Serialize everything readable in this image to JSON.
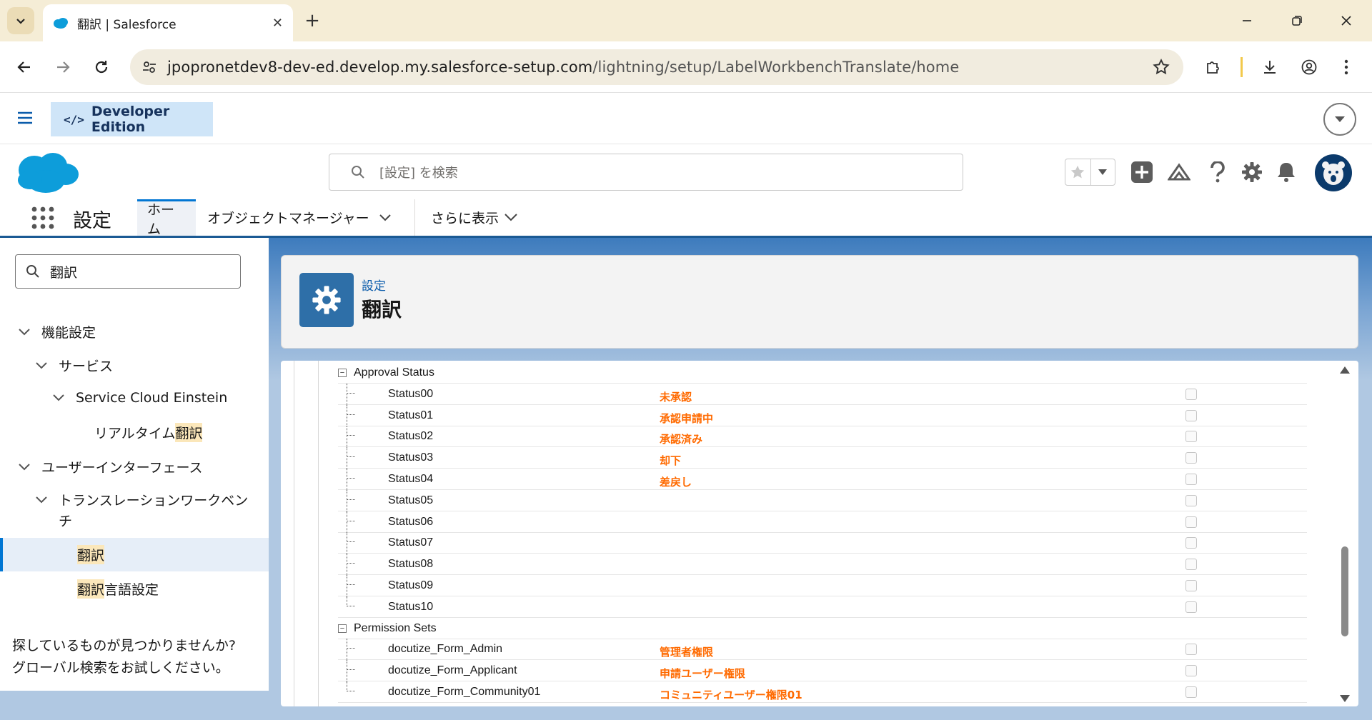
{
  "browser": {
    "tab_title": "翻訳 | Salesforce",
    "url_host": "jpopronetdev8-dev-ed.develop.my.salesforce-setup.com",
    "url_path": "/lightning/setup/LabelWorkbenchTranslate/home"
  },
  "devbar": {
    "edition_label": "Developer Edition"
  },
  "header": {
    "search_placeholder": "[設定] を検索"
  },
  "appnav": {
    "app_name": "設定",
    "tabs": [
      {
        "label": "ホーム"
      },
      {
        "label": "オブジェクトマネージャー"
      },
      {
        "label": "さらに表示"
      }
    ]
  },
  "sidebar": {
    "search_value": "翻訳",
    "items": [
      {
        "label": "機能設定"
      },
      {
        "label": "サービス"
      },
      {
        "label": "Service Cloud Einstein"
      },
      {
        "label_pre": "リアルタイム",
        "label_hl": "翻訳"
      },
      {
        "label": "ユーザーインターフェース"
      },
      {
        "label_line1": "トランスレーションワークベン",
        "label_line2": "チ"
      },
      {
        "label_hl": "翻訳"
      },
      {
        "label_hl": "翻訳",
        "label_post": "言語設定"
      }
    ],
    "help_line1": "探しているものが見つかりませんか?",
    "help_line2": "グローバル検索をお試しください。"
  },
  "page_header": {
    "breadcrumb": "設定",
    "title": "翻訳"
  },
  "translation_tree": {
    "groups": [
      {
        "title": "Approval Status",
        "expander": "−",
        "rows": [
          {
            "key": "Status00",
            "translation": "未承認"
          },
          {
            "key": "Status01",
            "translation": "承認申請中"
          },
          {
            "key": "Status02",
            "translation": "承認済み"
          },
          {
            "key": "Status03",
            "translation": "却下"
          },
          {
            "key": "Status04",
            "translation": "差戻し"
          },
          {
            "key": "Status05",
            "translation": ""
          },
          {
            "key": "Status06",
            "translation": ""
          },
          {
            "key": "Status07",
            "translation": ""
          },
          {
            "key": "Status08",
            "translation": ""
          },
          {
            "key": "Status09",
            "translation": ""
          },
          {
            "key": "Status10",
            "translation": ""
          }
        ]
      },
      {
        "title": "Permission Sets",
        "expander": "−",
        "rows": [
          {
            "key": "docutize_Form_Admin",
            "translation": "管理者権限"
          },
          {
            "key": "docutize_Form_Applicant",
            "translation": "申請ユーザー権限"
          },
          {
            "key": "docutize_Form_Community01",
            "translation": "コミュニティユーザー権限01"
          }
        ]
      }
    ]
  },
  "colors": {
    "brand": "#0176d3",
    "translation_text": "#ff6a00",
    "header_badge": "#2e6fa8"
  }
}
